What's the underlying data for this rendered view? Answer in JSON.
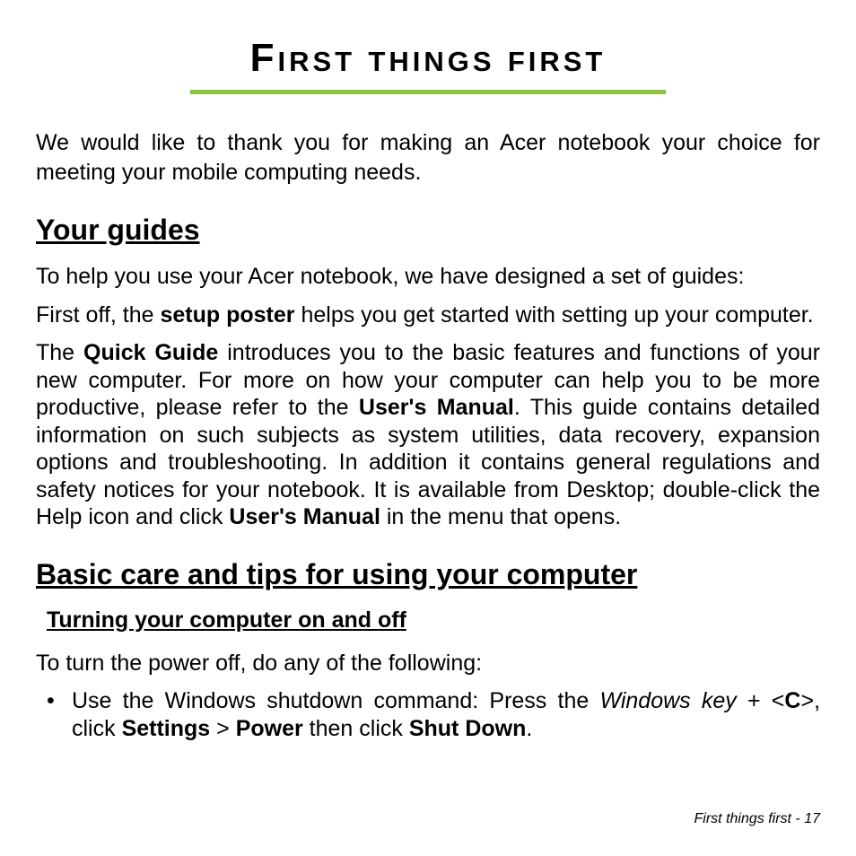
{
  "title": {
    "word1_first": "F",
    "word1_rest": "IRST",
    "word2": "THINGS",
    "word3": "FIRST"
  },
  "intro": "We would like to thank you for making an Acer notebook your choice for meeting your mobile computing needs.",
  "section1": {
    "heading": "Your guides",
    "p1": "To help you use your Acer notebook, we have designed a set of guides:",
    "p2_a": "First off, the ",
    "p2_b": "setup poster",
    "p2_c": " helps you get started with setting up your computer.",
    "p3_a": "The ",
    "p3_b": "Quick Guide",
    "p3_c": " introduces you to the basic features and functions of your new computer. For more on how your computer can help you to be more productive, please refer to the ",
    "p3_d": "User's Manual",
    "p3_e": ". This guide contains detailed information on such subjects as system utilities, data recovery, expansion options and troubleshooting. In addition it contains general regulations and safety notices for your notebook. It is available from Desktop; double-click the Help icon and click ",
    "p3_f": "User's Manual",
    "p3_g": " in the menu that opens."
  },
  "section2": {
    "heading": "Basic care and tips for using your computer",
    "sub1": {
      "heading": "Turning your computer on and off",
      "p1": "To turn the power off, do any of the following:",
      "bullet1_a": "Use the Windows shutdown command: Press the ",
      "bullet1_b": "Windows key",
      "bullet1_c": " + <",
      "bullet1_d": "C",
      "bullet1_e": ">, click ",
      "bullet1_f": "Settings",
      "bullet1_g": " > ",
      "bullet1_h": "Power",
      "bullet1_i": " then click ",
      "bullet1_j": "Shut Down",
      "bullet1_k": "."
    }
  },
  "footer": {
    "text": "First things first -  17"
  }
}
